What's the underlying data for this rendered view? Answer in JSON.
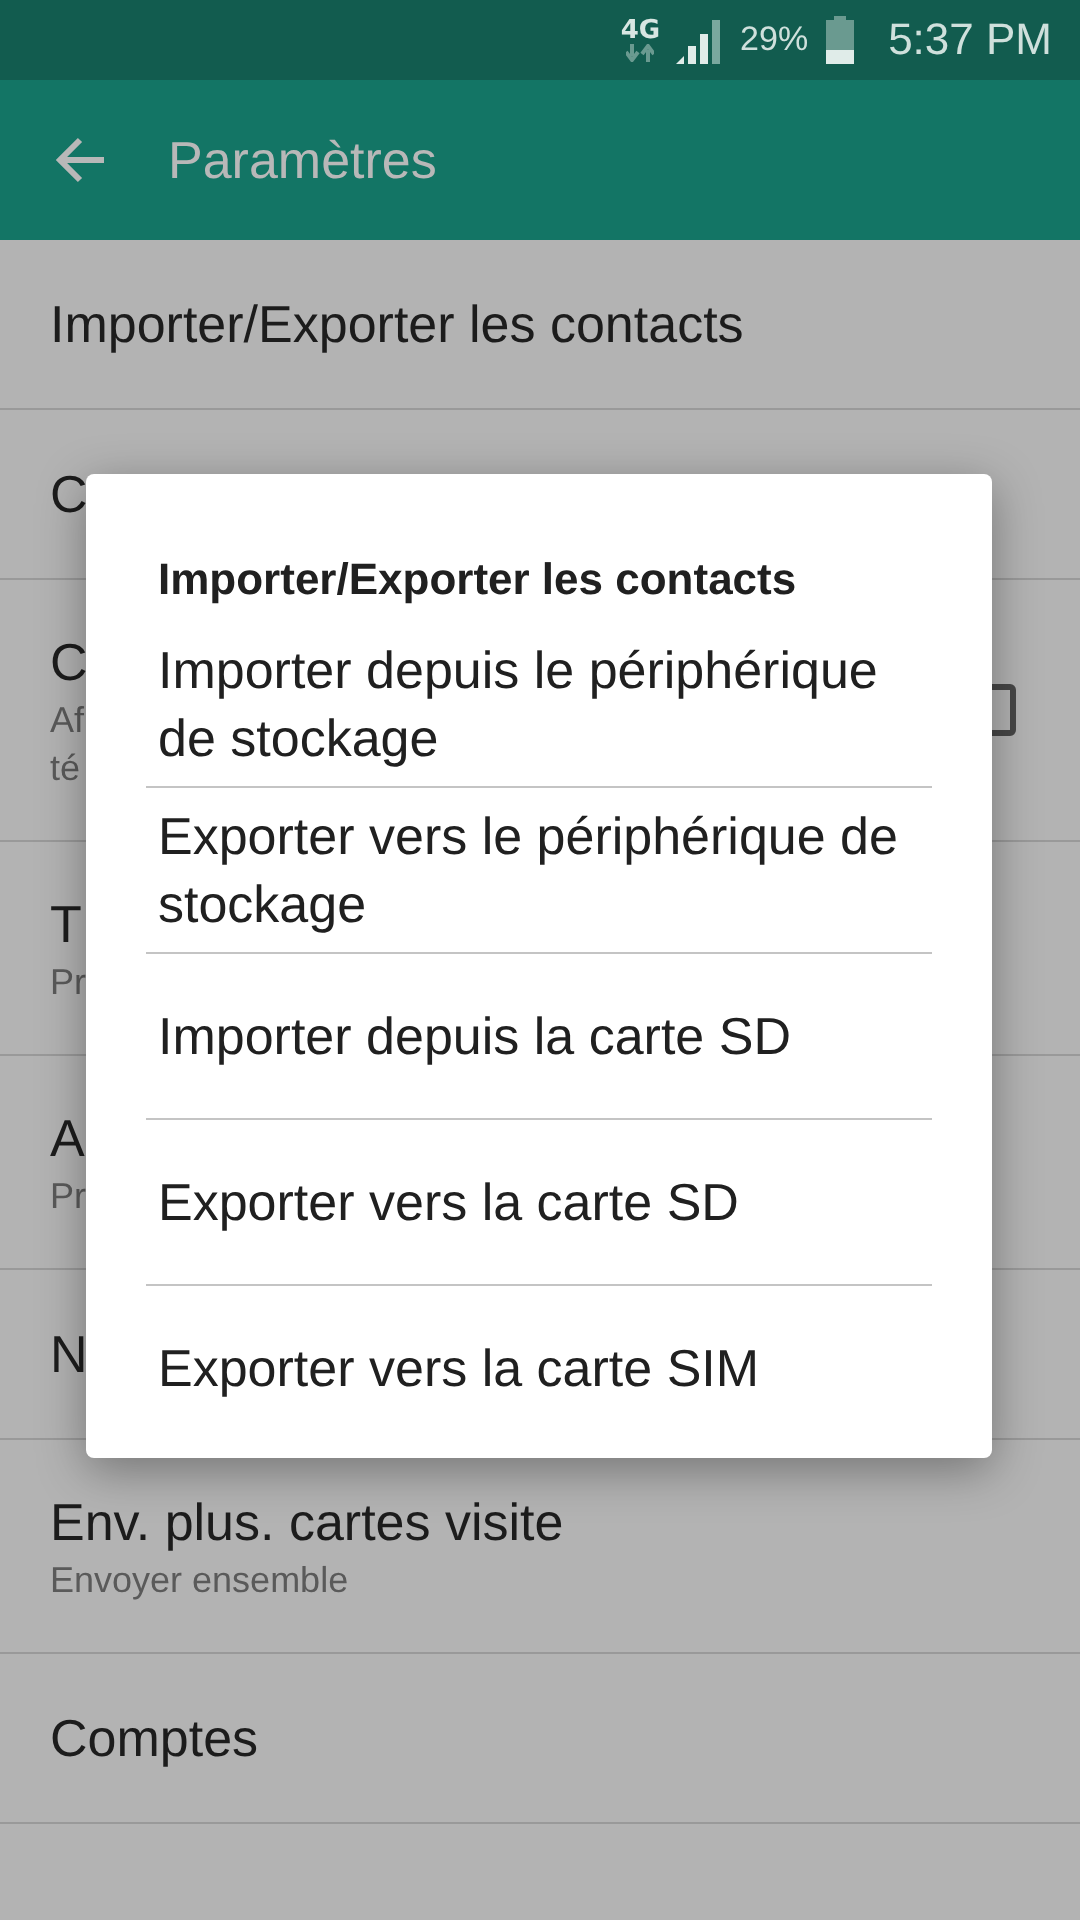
{
  "status_bar": {
    "network": "4G",
    "battery": "29%",
    "time": "5:37 PM"
  },
  "toolbar": {
    "title": "Paramètres"
  },
  "settings": [
    {
      "title": "Importer/Exporter les contacts"
    },
    {
      "title": "C"
    },
    {
      "title": "C",
      "subtitle": [
        "Af",
        "té"
      ],
      "checkbox": {
        "checked": false
      }
    },
    {
      "title": "T",
      "subtitle": [
        "Pr"
      ]
    },
    {
      "title": "A",
      "subtitle": [
        "Pr"
      ]
    },
    {
      "title": "N"
    },
    {
      "title": "Env. plus. cartes visite",
      "subtitle": [
        "Envoyer ensemble"
      ]
    },
    {
      "title": "Comptes"
    }
  ],
  "dialog": {
    "title": "Importer/Exporter les contacts",
    "options": [
      "Importer depuis le périphérique de stockage",
      "Exporter vers le périphérique de stockage",
      "Importer depuis la carte SD",
      "Exporter vers la carte SD",
      "Exporter vers la carte SIM"
    ]
  }
}
